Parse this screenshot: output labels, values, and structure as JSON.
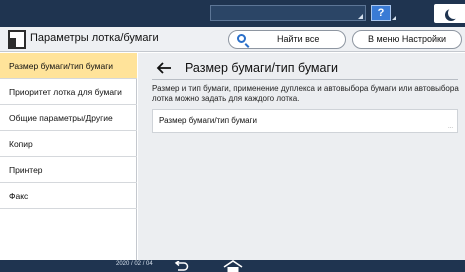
{
  "status_bar": {
    "help_label": "?"
  },
  "header": {
    "title": "Параметры лотка/бумаги",
    "search_label": "Найти все",
    "menu_label": "В меню Настройки"
  },
  "sidebar": {
    "items": [
      {
        "label": "Размер бумаги/тип бумаги",
        "active": true
      },
      {
        "label": "Приоритет лотка для бумаги",
        "active": false
      },
      {
        "label": "Общие параметры/Другие",
        "active": false
      },
      {
        "label": "Копир",
        "active": false
      },
      {
        "label": "Принтер",
        "active": false
      },
      {
        "label": "Факс",
        "active": false
      }
    ]
  },
  "main": {
    "title": "Размер бумаги/тип бумаги",
    "description": "Размер и тип бумаги, применение дуплекса и автовыбора бумаги или автовыбора лотка можно задать для каждого лотка.",
    "setting_row_label": "Размер бумаги/тип бумаги",
    "setting_row_ellipsis": "..."
  },
  "bottom_bar": {
    "date": "2020 / 02 / 04"
  },
  "colors": {
    "status_bar": "#1f3450",
    "active_item": "#ffe39a",
    "accent": "#2a6fc9"
  }
}
